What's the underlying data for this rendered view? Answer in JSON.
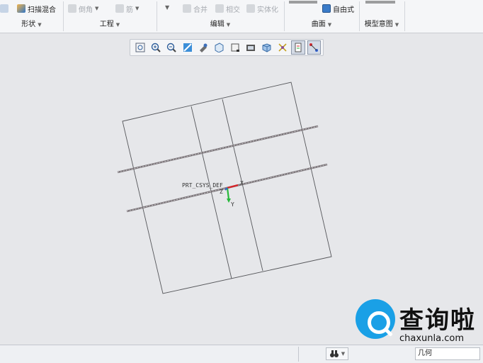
{
  "ribbon": {
    "top_items": [
      {
        "label": "扫描混合",
        "icon": "sweep-blend-icon",
        "disabled": false
      },
      {
        "label": "倒角",
        "icon": "chamfer-icon",
        "disabled": true
      },
      {
        "label": "筋",
        "icon": "rib-icon",
        "disabled": true
      },
      {
        "label": "合并",
        "icon": "merge-icon",
        "disabled": true
      },
      {
        "label": "相交",
        "icon": "intersect-icon",
        "disabled": true
      },
      {
        "label": "实体化",
        "icon": "solidify-icon",
        "disabled": true
      },
      {
        "label": "自由式",
        "icon": "freestyle-icon",
        "disabled": false
      }
    ],
    "groups": [
      {
        "label": "形状"
      },
      {
        "label": "工程"
      },
      {
        "label": "编辑"
      },
      {
        "label": "曲面"
      },
      {
        "label": "模型意图"
      }
    ]
  },
  "graphics_toolbar": {
    "buttons": [
      {
        "icon": "refit-icon"
      },
      {
        "icon": "zoom-in-icon"
      },
      {
        "icon": "zoom-out-icon"
      },
      {
        "icon": "repaint-icon"
      },
      {
        "icon": "spin-center-icon"
      },
      {
        "icon": "display-style-icon"
      },
      {
        "icon": "saved-orientations-icon"
      },
      {
        "icon": "view-manager-icon"
      },
      {
        "icon": "perspective-icon"
      },
      {
        "icon": "datum-display-icon"
      },
      {
        "icon": "annotation-display-icon",
        "active": true
      },
      {
        "icon": "sketch-display-icon",
        "active": true
      }
    ]
  },
  "viewport": {
    "csys_label": "PRT_CSYS_DEF",
    "axis_x": "X",
    "axis_y": "Y",
    "axis_z": "Z",
    "colors": {
      "x_axis": "#d9252b",
      "y_axis": "#27b93a",
      "z_axis": "#2f5fd0",
      "datum_plane": "#55565a",
      "curve": "#7a7478"
    }
  },
  "status_bar": {
    "filter_icon": "binoculars-icon",
    "selection_type": "几何"
  },
  "watermark": {
    "text_cn": "查询啦",
    "text_en": "chaxunla.com"
  }
}
